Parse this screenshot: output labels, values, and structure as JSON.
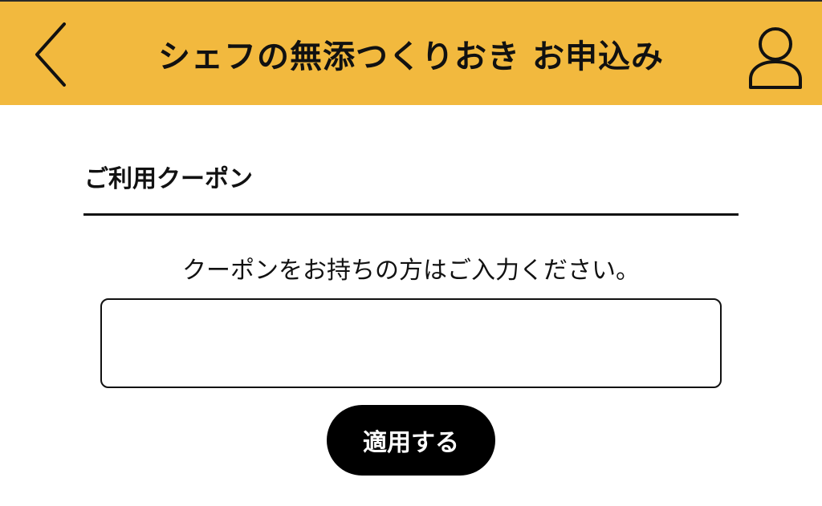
{
  "header": {
    "title": "シェフの無添つくりおき お申込み",
    "background_color": "#f2b93e",
    "back_icon": "chevron-left-icon",
    "account_icon": "user-icon"
  },
  "coupon": {
    "heading": "ご利用クーポン",
    "instruction": "クーポンをお持ちの方はご入力ください。",
    "input_value": "",
    "input_placeholder": "",
    "apply_label": "適用する"
  }
}
